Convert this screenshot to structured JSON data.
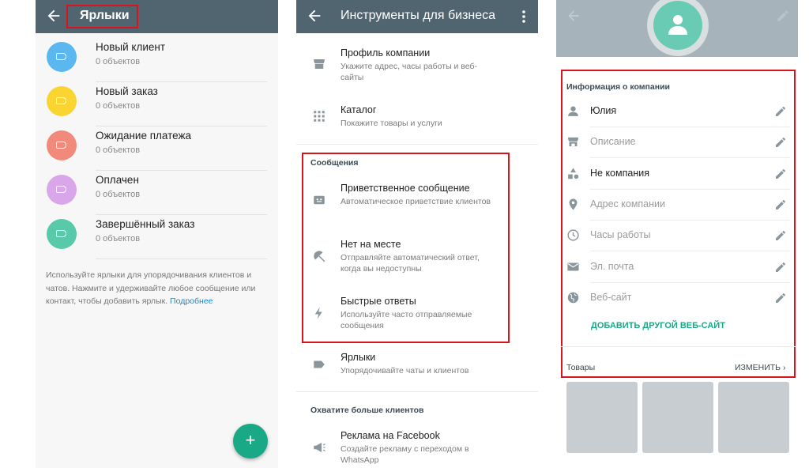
{
  "labels_screen": {
    "title": "Ярлыки",
    "items": [
      {
        "name": "Новый клиент",
        "count": "0 объектов",
        "color": "#5ab7f0"
      },
      {
        "name": "Новый заказ",
        "count": "0 объектов",
        "color": "#fad430"
      },
      {
        "name": "Ожидание платежа",
        "count": "0 объектов",
        "color": "#f28a7b"
      },
      {
        "name": "Оплачен",
        "count": "0 объектов",
        "color": "#d9a7e9"
      },
      {
        "name": "Завершённый заказ",
        "count": "0 объектов",
        "color": "#58caa9"
      }
    ],
    "help_text": "Используйте ярлыки для упорядочивания клиентов и чатов. Нажмите и удерживайте любое сообщение или контакт, чтобы добавить ярлык.",
    "help_link": "Подробнее",
    "fab_label": "+"
  },
  "business_tools": {
    "title": "Инструменты для бизнеса",
    "profile": {
      "title": "Профиль компании",
      "subtitle": "Укажите адрес, часы работы и веб-сайты"
    },
    "catalog": {
      "title": "Каталог",
      "subtitle": "Покажите товары и услуги"
    },
    "messages_section": "Сообщения",
    "greeting": {
      "title": "Приветственное сообщение",
      "subtitle": "Автоматическое приветствие клиентов"
    },
    "away": {
      "title": "Нет на месте",
      "subtitle": "Отправляйте автоматический ответ, когда вы недоступны"
    },
    "quick_replies": {
      "title": "Быстрые ответы",
      "subtitle": "Используйте часто отправляемые сообщения"
    },
    "labels": {
      "title": "Ярлыки",
      "subtitle": "Упорядочивайте чаты и клиентов"
    },
    "reach_section": "Охватите больше клиентов",
    "facebook_ads": {
      "title": "Реклама на Facebook",
      "subtitle": "Создайте рекламу с переходом в WhatsApp"
    }
  },
  "company_profile": {
    "info_header": "Информация о компании",
    "fields": [
      {
        "value": "Юлия",
        "filled": true,
        "icon": "person-icon"
      },
      {
        "value": "Описание",
        "filled": false,
        "icon": "store-icon"
      },
      {
        "value": "Не компания",
        "filled": true,
        "icon": "category-icon"
      },
      {
        "value": "Адрес компании",
        "filled": false,
        "icon": "location-icon"
      },
      {
        "value": "Часы работы",
        "filled": false,
        "icon": "clock-icon"
      },
      {
        "value": "Эл. почта",
        "filled": false,
        "icon": "mail-icon"
      },
      {
        "value": "Веб-сайт",
        "filled": false,
        "icon": "globe-icon"
      }
    ],
    "add_website": "ДОБАВИТЬ ДРУГОЙ ВЕБ-САЙТ",
    "goods_label": "Товары",
    "goods_change": "ИЗМЕНИТЬ"
  },
  "colors": {
    "appbar": "#516570",
    "accent": "#1aa987",
    "highlight": "#d9141e",
    "filled_text": "#1f1f1f",
    "placeholder_text": "#9a9a9a"
  }
}
